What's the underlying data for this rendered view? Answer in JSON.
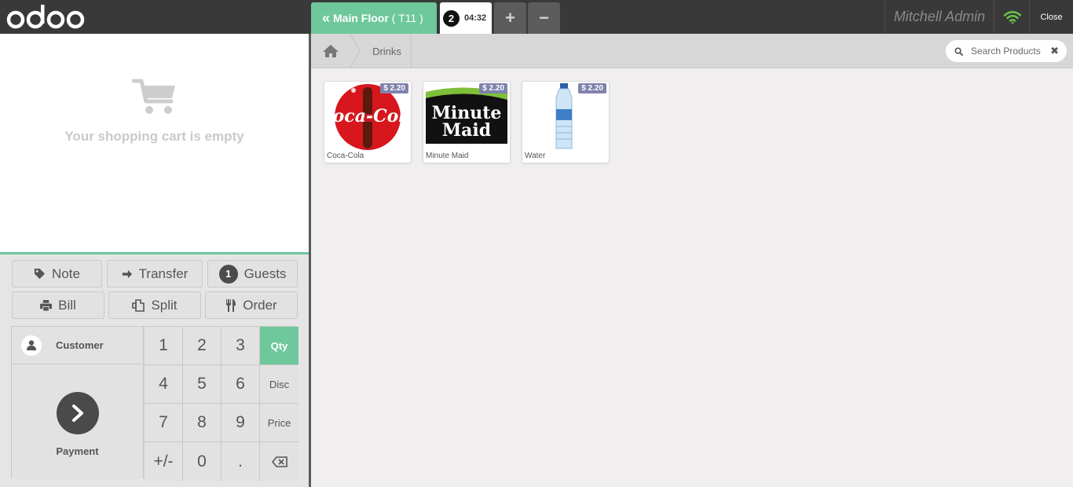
{
  "header": {
    "logo": "odoo",
    "floor_label": "Main Floor",
    "table_label": "( T11 )",
    "order_number": "2",
    "order_time": "04:32",
    "user": "Mitchell Admin",
    "close_label": "Close"
  },
  "cart": {
    "empty_text": "Your shopping cart is empty"
  },
  "control_buttons": {
    "note": "Note",
    "transfer": "Transfer",
    "guests_count": "1",
    "guests": "Guests",
    "bill": "Bill",
    "split": "Split",
    "order": "Order"
  },
  "numpad": {
    "customer": "Customer",
    "payment": "Payment",
    "keys": [
      "1",
      "2",
      "3",
      "4",
      "5",
      "6",
      "7",
      "8",
      "9",
      "+/-",
      "0",
      "."
    ],
    "modes": [
      "Qty",
      "Disc",
      "Price"
    ]
  },
  "breadcrumb": {
    "category": "Drinks"
  },
  "search": {
    "placeholder": "Search Products"
  },
  "products": [
    {
      "name": "Coca-Cola",
      "price": "$ 2.20"
    },
    {
      "name": "Minute Maid",
      "price": "$ 2.20"
    },
    {
      "name": "Water",
      "price": "$ 2.20"
    }
  ],
  "colors": {
    "accent": "#6ec89b",
    "header_bg": "#393939",
    "price_tag": "#7f82ac"
  }
}
